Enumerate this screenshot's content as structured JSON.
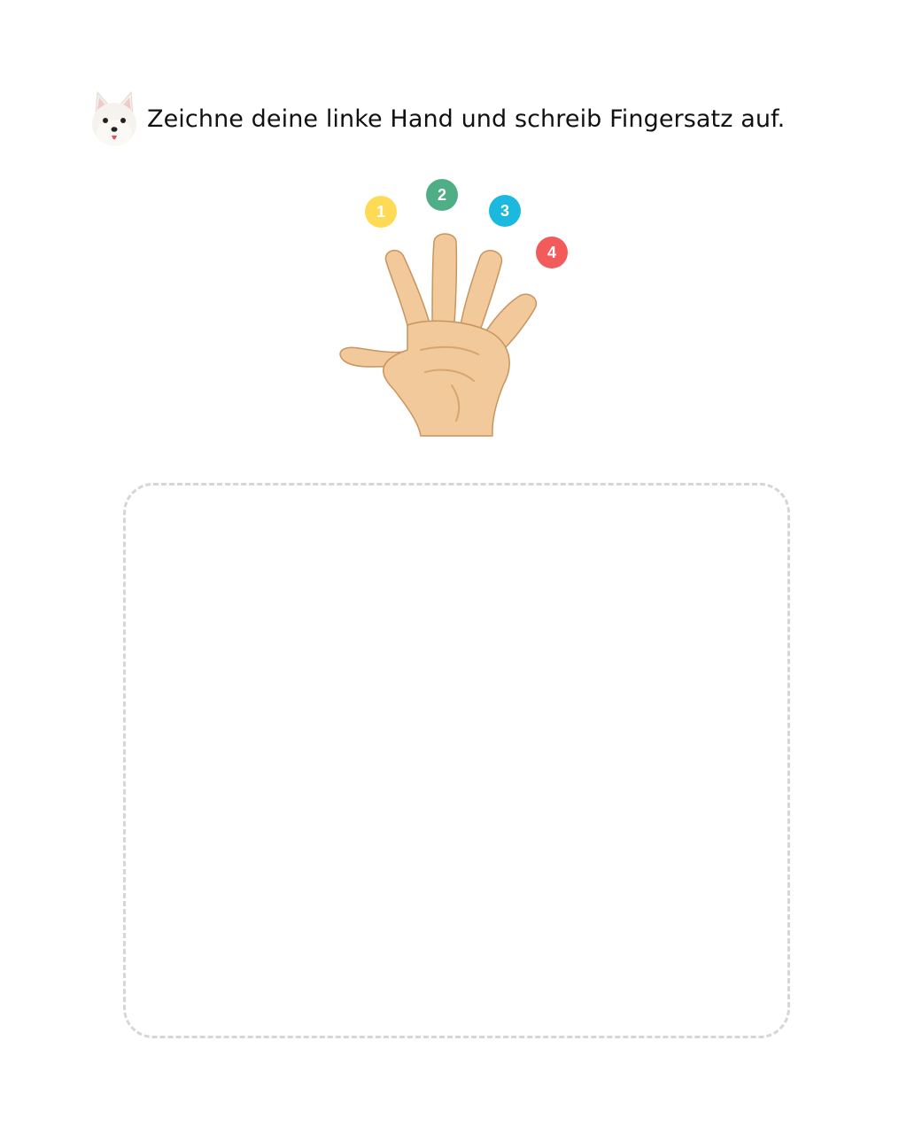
{
  "header": {
    "icon": "westie-dog-face-icon",
    "instruction": "Zeichne deine linke Hand und schreib Fingersatz auf."
  },
  "hand": {
    "icon": "open-hand-illustration",
    "badges": [
      {
        "label": "1",
        "color": "#FFDA55"
      },
      {
        "label": "2",
        "color": "#4FAE86"
      },
      {
        "label": "3",
        "color": "#1BB8E0"
      },
      {
        "label": "4",
        "color": "#F35A5A"
      }
    ]
  },
  "drawing_area": {
    "border_color": "#D6D6D6"
  }
}
